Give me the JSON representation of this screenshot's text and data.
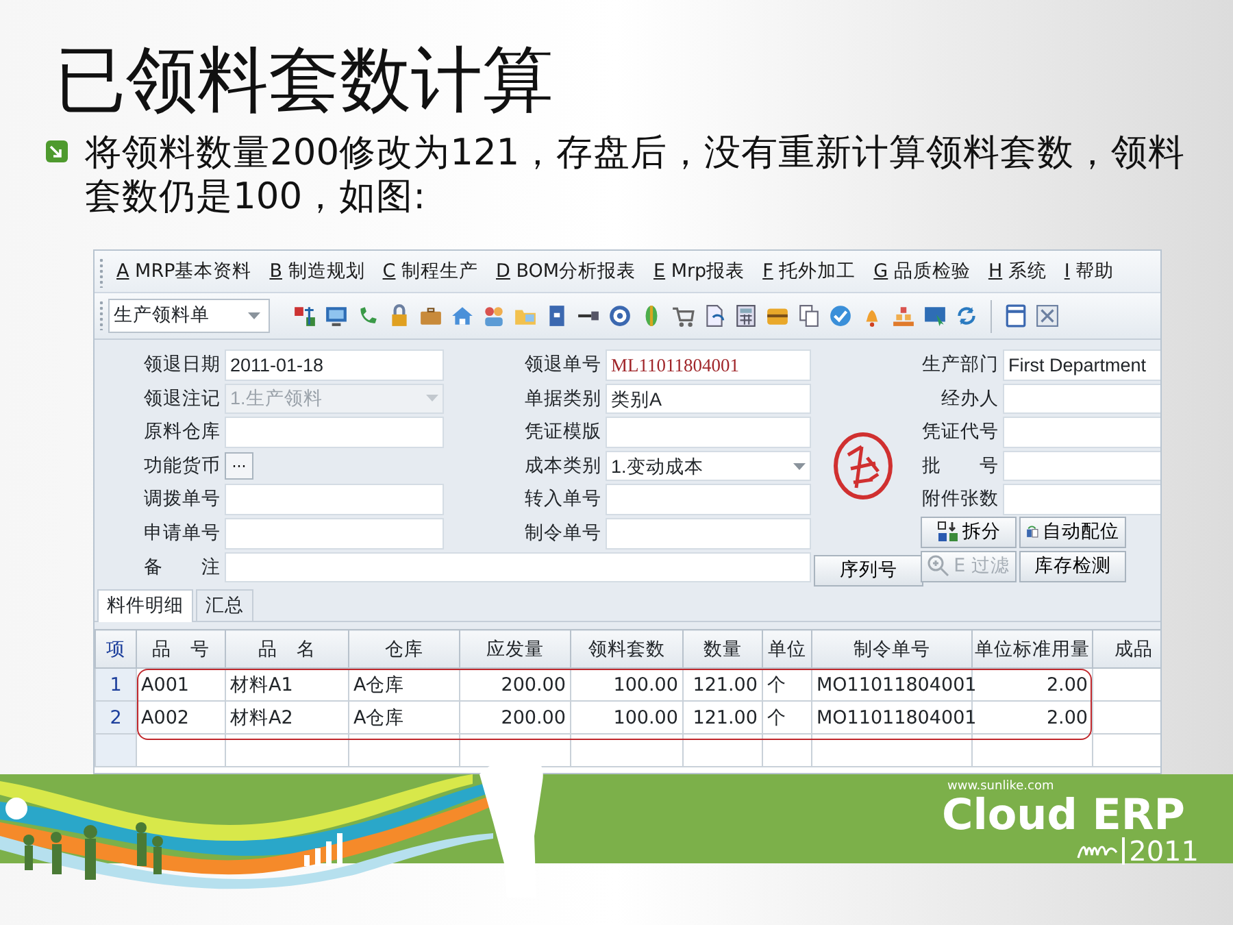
{
  "slide": {
    "title": "已领料套数计算",
    "bullet": "将领料数量200修改为121，存盘后，没有重新计算领料套数，领料套数仍是100，如图:"
  },
  "window": {
    "menu": [
      {
        "key": "A",
        "label": " MRP基本资料"
      },
      {
        "key": "B",
        "label": " 制造规划"
      },
      {
        "key": "C",
        "label": " 制程生产"
      },
      {
        "key": "D",
        "label": " BOM分析报表"
      },
      {
        "key": "E",
        "label": " Mrp报表"
      },
      {
        "key": "F",
        "label": " 托外加工"
      },
      {
        "key": "G",
        "label": " 品质检验"
      },
      {
        "key": "H",
        "label": " 系统"
      },
      {
        "key": "I",
        "label": " 帮助"
      }
    ],
    "toolbar": {
      "combo": "生产领料单"
    },
    "form": {
      "left": [
        {
          "label": "领退日期",
          "value": "2011-01-18",
          "kind": "text"
        },
        {
          "label": "领退注记",
          "value": "1.生产领料",
          "kind": "combo",
          "disabled": true
        },
        {
          "label": "原料仓库",
          "kind": "text"
        },
        {
          "label": "功能货币",
          "button": "···",
          "kind": "ellipsis"
        },
        {
          "label": "调拨单号",
          "kind": "text"
        },
        {
          "label": "申请单号",
          "kind": "text"
        }
      ],
      "middle": [
        {
          "label": "领退单号",
          "value": "ML11011804001",
          "kind": "code"
        },
        {
          "label": "单据类别",
          "value": "类别A",
          "kind": "text"
        },
        {
          "label": "凭证模版",
          "kind": "text"
        },
        {
          "label": "成本类别",
          "value": "1.变动成本",
          "kind": "combo",
          "disabled": false
        },
        {
          "label": "转入单号",
          "kind": "text"
        },
        {
          "label": "制令单号",
          "kind": "text"
        }
      ],
      "right": [
        {
          "label": "生产部门",
          "value": "First Department",
          "kind": "text"
        },
        {
          "label": "经办人",
          "kind": "text"
        },
        {
          "label": "凭证代号",
          "kind": "text"
        },
        {
          "label": "批　　号",
          "kind": "text"
        },
        {
          "label": "附件张数",
          "kind": "text"
        }
      ],
      "remark_label": "备　　注",
      "serial_button": "序列号",
      "buttons": [
        {
          "label": "拆分",
          "disabled": false
        },
        {
          "label": "自动配位",
          "disabled": false
        },
        {
          "label": "E 过滤",
          "disabled": true
        },
        {
          "label": "库存检测",
          "disabled": false
        }
      ]
    },
    "tabs": [
      {
        "label": "料件明细",
        "selected": true
      },
      {
        "label": "汇总",
        "selected": false
      }
    ],
    "table": {
      "columns": [
        "项",
        "品　号",
        "品　名",
        "仓库",
        "应发量",
        "领料套数",
        "数量",
        "单位",
        "制令单号",
        "单位标准用量",
        "成品"
      ],
      "rows": [
        {
          "cells": [
            "1",
            "A001",
            "材料A1",
            "A仓库",
            "200.00",
            "100.00",
            "121.00",
            "个",
            "MO11011804001",
            "2.00"
          ],
          "highlighted": true
        },
        {
          "cells": [
            "2",
            "A002",
            "材料A2",
            "A仓库",
            "200.00",
            "100.00",
            "121.00",
            "个",
            "MO11011804001",
            "2.00"
          ],
          "highlighted": true
        }
      ]
    }
  },
  "banner": {
    "url": "www.sunlike.com",
    "product": "Cloud ERP",
    "year": "2011"
  }
}
